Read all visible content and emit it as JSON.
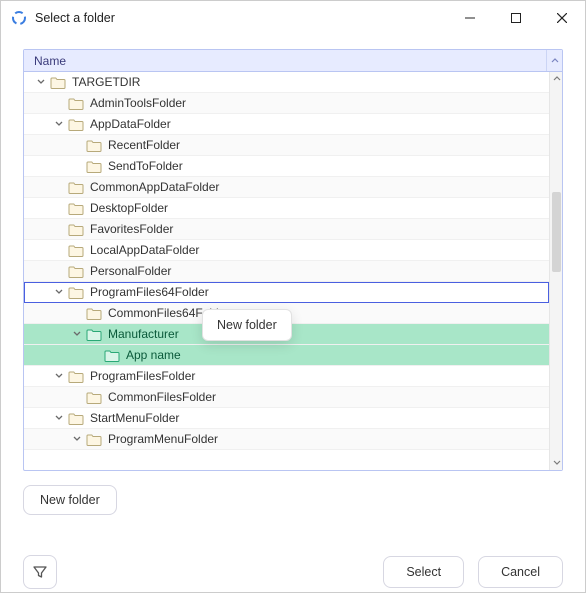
{
  "window": {
    "title": "Select a folder"
  },
  "tree": {
    "header": "Name",
    "rows": [
      {
        "label": "TARGETDIR",
        "depth": 0,
        "chev": "down",
        "alt": false,
        "hl": false,
        "sel": false
      },
      {
        "label": "AdminToolsFolder",
        "depth": 1,
        "chev": "none",
        "alt": true,
        "hl": false,
        "sel": false
      },
      {
        "label": "AppDataFolder",
        "depth": 1,
        "chev": "down",
        "alt": false,
        "hl": false,
        "sel": false
      },
      {
        "label": "RecentFolder",
        "depth": 2,
        "chev": "none",
        "alt": true,
        "hl": false,
        "sel": false
      },
      {
        "label": "SendToFolder",
        "depth": 2,
        "chev": "none",
        "alt": false,
        "hl": false,
        "sel": false
      },
      {
        "label": "CommonAppDataFolder",
        "depth": 1,
        "chev": "none",
        "alt": true,
        "hl": false,
        "sel": false
      },
      {
        "label": "DesktopFolder",
        "depth": 1,
        "chev": "none",
        "alt": false,
        "hl": false,
        "sel": false
      },
      {
        "label": "FavoritesFolder",
        "depth": 1,
        "chev": "none",
        "alt": true,
        "hl": false,
        "sel": false
      },
      {
        "label": "LocalAppDataFolder",
        "depth": 1,
        "chev": "none",
        "alt": false,
        "hl": false,
        "sel": false
      },
      {
        "label": "PersonalFolder",
        "depth": 1,
        "chev": "none",
        "alt": true,
        "hl": false,
        "sel": false
      },
      {
        "label": "ProgramFiles64Folder",
        "depth": 1,
        "chev": "down",
        "alt": false,
        "hl": false,
        "sel": true
      },
      {
        "label": "CommonFiles64Folder",
        "depth": 2,
        "chev": "none",
        "alt": true,
        "hl": false,
        "sel": false
      },
      {
        "label": "Manufacturer",
        "depth": 2,
        "chev": "down",
        "alt": false,
        "hl": true,
        "sel": false
      },
      {
        "label": "App name",
        "depth": 3,
        "chev": "none",
        "alt": true,
        "hl": true,
        "sel": false
      },
      {
        "label": "ProgramFilesFolder",
        "depth": 1,
        "chev": "down",
        "alt": false,
        "hl": false,
        "sel": false
      },
      {
        "label": "CommonFilesFolder",
        "depth": 2,
        "chev": "none",
        "alt": true,
        "hl": false,
        "sel": false
      },
      {
        "label": "StartMenuFolder",
        "depth": 1,
        "chev": "down",
        "alt": false,
        "hl": false,
        "sel": false
      },
      {
        "label": "ProgramMenuFolder",
        "depth": 2,
        "chev": "down",
        "alt": true,
        "hl": false,
        "sel": false
      }
    ]
  },
  "tooltip": {
    "text": "New folder"
  },
  "buttons": {
    "new_folder": "New folder",
    "select": "Select",
    "cancel": "Cancel"
  }
}
